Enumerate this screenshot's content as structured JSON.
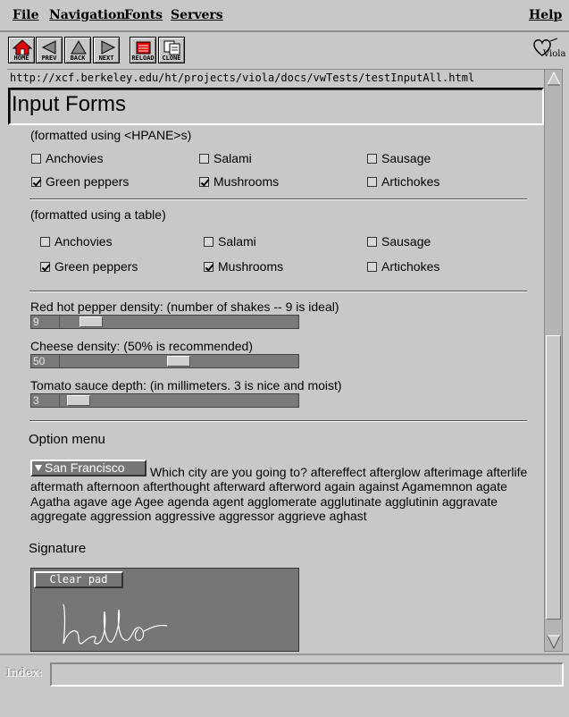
{
  "menubar": {
    "file": "File",
    "navigation": "Navigation",
    "fonts": "Fonts",
    "servers": "Servers",
    "help": "Help"
  },
  "toolbar": {
    "home": "HOME",
    "prev": "PREV",
    "back": "BACK",
    "next": "NEXT",
    "reload": "RELOAD",
    "clone": "CLONE",
    "logo": "Viola"
  },
  "url": "http://xcf.berkeley.edu/ht/projects/viola/docs/vwTests/testInputAll.html",
  "page": {
    "title": "Input Forms",
    "hpane_caption": "(formatted using <HPANE>s)",
    "table_caption": "(formatted using a table)",
    "toppings": {
      "anchovies": "Anchovies",
      "salami": "Salami",
      "sausage": "Sausage",
      "green_peppers": "Green peppers",
      "mushrooms": "Mushrooms",
      "artichokes": "Artichokes"
    },
    "sliders": [
      {
        "label": "Red hot pepper density:  (number of shakes -- 9 is ideal)",
        "value": "9"
      },
      {
        "label": "Cheese density:  (50% is recommended)",
        "value": "50"
      },
      {
        "label": "Tomato sauce depth:  (in millimeters. 3 is nice and moist)",
        "value": "3"
      }
    ],
    "option_heading": "Option menu",
    "option_selected": "San Francisco",
    "option_text": "Which city are you going to? aftereffect afterglow afterimage afterlife aftermath afternoon afterthought afterward afterword again against Agamemnon agate Agatha agave age Agee agenda agent agglomerate agglutinate agglutinin aggravate aggregate aggression aggressive aggressor aggrieve aghast",
    "signature_heading": "Signature",
    "clear_pad": "Clear pad"
  },
  "index": {
    "label": "Index:",
    "value": ""
  }
}
